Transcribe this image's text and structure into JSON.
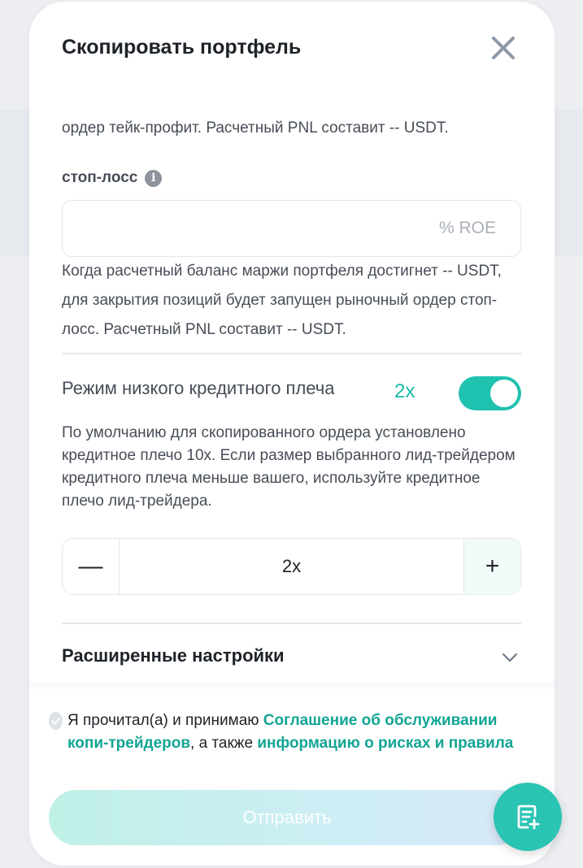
{
  "modal": {
    "title": "Скопировать портфель"
  },
  "take_profit": {
    "note": "ордер тейк-профит. Расчетный PNL составит -- USDT."
  },
  "stop_loss": {
    "label": "стоп-лосс",
    "info_glyph": "i",
    "value": "",
    "placeholder": "% ROE",
    "note": "Когда расчетный баланс маржи портфеля достигнет -- USDT, для закрытия позиций будет запущен рыночный ордер стоп-лосс. Расчетный PNL составит -- USDT."
  },
  "low_leverage": {
    "label": "Режим низкого кредитного плеча",
    "value": "2x",
    "enabled": true,
    "note": "По умолчанию для скопированного ордера установлено кредитное плечо 10x. Если размер выбранного лид-трейдером кредитного плеча меньше вашего, используйте кредитное плечо лид-трейдера."
  },
  "stepper": {
    "minus": "—",
    "plus": "+",
    "value": "2x"
  },
  "advanced": {
    "label": "Расширенные настройки"
  },
  "agreement": {
    "text_1": "Я прочитал(а) и принимаю ",
    "link_1": "Соглашение об обслуживании копи-трейдеров",
    "text_2": ", а также ",
    "link_2": "информацию о рисках и правила",
    "checked": false
  },
  "submit": {
    "label": "Отправить"
  },
  "colors": {
    "accent": "#1fc2ae",
    "link": "#12a594",
    "fab": "#2ac4b3"
  },
  "icons": {
    "close": "close-icon",
    "info": "info-icon",
    "chevron": "chevron-down-icon",
    "fab": "order-list-add-icon"
  }
}
